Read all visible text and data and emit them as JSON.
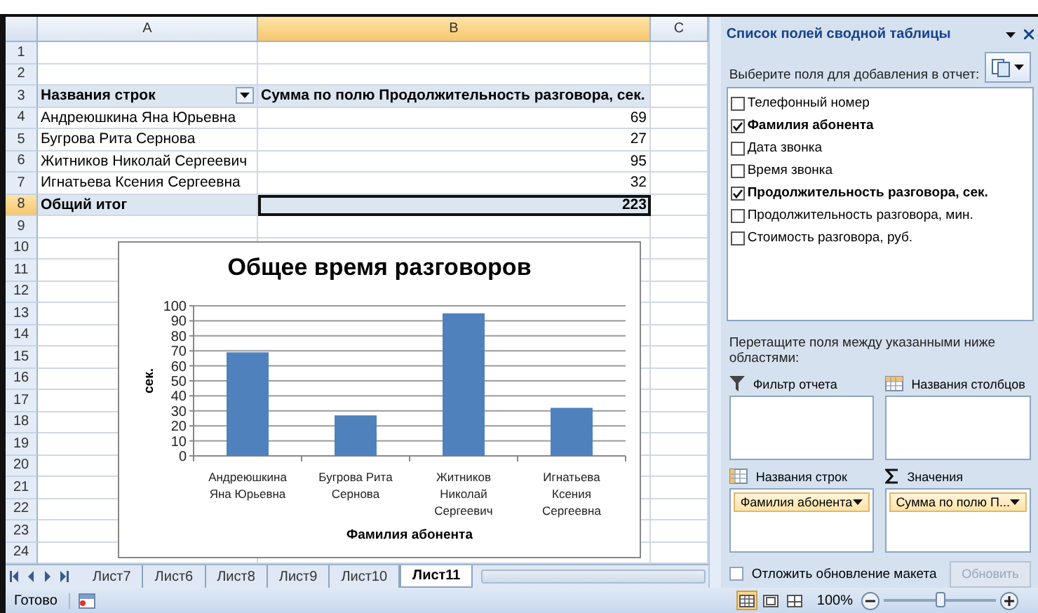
{
  "sheet": {
    "columns": [
      {
        "label": "A",
        "selected": false
      },
      {
        "label": "B",
        "selected": true
      },
      {
        "label": "C",
        "selected": false
      }
    ],
    "rows": [
      {
        "number": "1",
        "kind": "blank",
        "selected": false
      },
      {
        "number": "2",
        "kind": "blank",
        "selected": false
      },
      {
        "number": "3",
        "kind": "header",
        "a": "Названия строк",
        "b": "Сумма по полю Продолжительность разговора, сек.",
        "selected": false
      },
      {
        "number": "4",
        "kind": "data",
        "a": "Андреюшкина Яна Юрьевна",
        "b": "69",
        "selected": false
      },
      {
        "number": "5",
        "kind": "data",
        "a": "Бугрова Рита Сернова",
        "b": "27",
        "selected": false
      },
      {
        "number": "6",
        "kind": "data",
        "a": "Житников Николай Сергеевич",
        "b": "95",
        "selected": false
      },
      {
        "number": "7",
        "kind": "data",
        "a": "Игнатьева Ксения Сергеевна",
        "b": "32",
        "selected": false
      },
      {
        "number": "8",
        "kind": "total",
        "a": "Общий итог",
        "b": "223",
        "selected": true
      },
      {
        "number": "9",
        "kind": "blank",
        "selected": false
      },
      {
        "number": "10",
        "kind": "blank",
        "selected": false
      },
      {
        "number": "11",
        "kind": "blank",
        "selected": false
      },
      {
        "number": "12",
        "kind": "blank",
        "selected": false
      },
      {
        "number": "13",
        "kind": "blank",
        "selected": false
      },
      {
        "number": "14",
        "kind": "blank",
        "selected": false
      },
      {
        "number": "15",
        "kind": "blank",
        "selected": false
      },
      {
        "number": "16",
        "kind": "blank",
        "selected": false
      },
      {
        "number": "17",
        "kind": "blank",
        "selected": false
      },
      {
        "number": "18",
        "kind": "blank",
        "selected": false
      },
      {
        "number": "19",
        "kind": "blank",
        "selected": false
      },
      {
        "number": "20",
        "kind": "blank",
        "selected": false
      },
      {
        "number": "21",
        "kind": "blank",
        "selected": false
      },
      {
        "number": "22",
        "kind": "blank",
        "selected": false
      },
      {
        "number": "23",
        "kind": "blank",
        "selected": false
      },
      {
        "number": "24",
        "kind": "blank",
        "selected": false
      }
    ],
    "chart": {
      "chart_data": {
        "type": "bar",
        "title": "Общее время разговоров",
        "xlabel": "Фамилия абонента",
        "ylabel": "сек.",
        "categories": [
          "Андреюшкина Яна Юрьевна",
          "Бугрова Рита Сернова",
          "Житников Николай Сергеевич",
          "Игнатьева Ксения Сергеевна"
        ],
        "series": [
          {
            "color": "#4f81bd",
            "values": [
              69,
              27,
              95,
              32
            ]
          }
        ],
        "grid": true,
        "ylim": [
          0,
          100
        ],
        "yticks": [
          0,
          10,
          20,
          30,
          40,
          50,
          60,
          70,
          80,
          90,
          100
        ]
      }
    },
    "sheet_tabs": [
      {
        "label": "Лист7",
        "selected": false
      },
      {
        "label": "Лист6",
        "selected": false
      },
      {
        "label": "Лист8",
        "selected": false
      },
      {
        "label": "Лист9",
        "selected": false
      },
      {
        "label": "Лист10",
        "selected": false
      },
      {
        "label": "Лист11",
        "selected": true
      }
    ]
  },
  "pivot_panel": {
    "title": "Список полей сводной таблицы",
    "prompt": "Выберите поля для добавления в отчет:",
    "fields": [
      {
        "label": "Телефонный номер",
        "checked": false
      },
      {
        "label": "Фамилия абонента",
        "checked": true
      },
      {
        "label": "Дата звонка",
        "checked": false
      },
      {
        "label": "Время звонка",
        "checked": false
      },
      {
        "label": "Продолжительность разговора, сек.",
        "checked": true
      },
      {
        "label": "Продолжительность разговора, мин.",
        "checked": false
      },
      {
        "label": "Стоимость разговора, руб.",
        "checked": false
      }
    ],
    "drag_hint": "Перетащите поля между указанными ниже областями:",
    "areas": [
      {
        "kind": "filter",
        "label": "Фильтр отчета"
      },
      {
        "kind": "columns",
        "label": "Названия столбцов"
      },
      {
        "kind": "rows",
        "label": "Названия строк",
        "chip": "Фамилия абонента"
      },
      {
        "kind": "values",
        "label": "Значения",
        "chip": "Сумма по полю П..."
      }
    ],
    "defer_update": {
      "label": "Отложить обновление макета",
      "checked": false
    },
    "update_button": {
      "label": "Обновить",
      "disabled": true
    }
  },
  "status_bar": {
    "text": "Готово",
    "views": [
      {
        "kind": "normal",
        "selected": true
      },
      {
        "kind": "layout",
        "selected": false
      },
      {
        "kind": "page",
        "selected": false
      }
    ],
    "zoom": "100%",
    "zoom_slider": {
      "level": 0.5
    }
  }
}
